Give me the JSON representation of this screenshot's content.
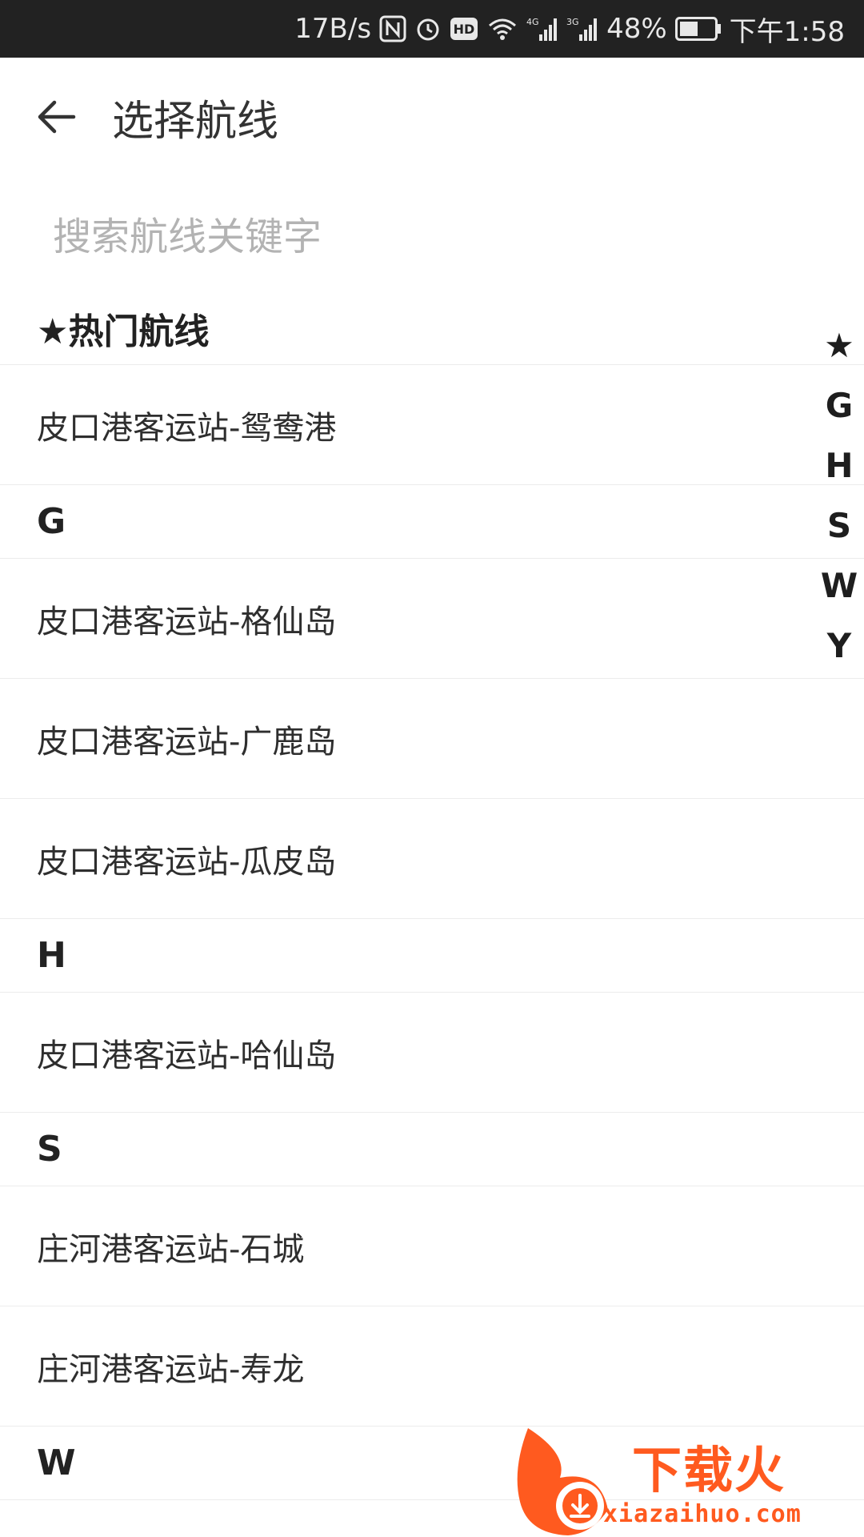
{
  "status_bar": {
    "net_speed": "17B/s",
    "battery": "48%",
    "time": "下午1:58"
  },
  "header": {
    "title": "选择航线"
  },
  "search": {
    "placeholder": "搜索航线关键字"
  },
  "sections": [
    {
      "header": "★热门航线",
      "items": [
        "皮口港客运站-鸳鸯港"
      ]
    },
    {
      "header": "G",
      "items": [
        "皮口港客运站-格仙岛",
        "皮口港客运站-广鹿岛",
        "皮口港客运站-瓜皮岛"
      ]
    },
    {
      "header": "H",
      "items": [
        "皮口港客运站-哈仙岛"
      ]
    },
    {
      "header": "S",
      "items": [
        "庄河港客运站-石城",
        "庄河港客运站-寿龙"
      ]
    },
    {
      "header": "W",
      "items": []
    }
  ],
  "index_bar": [
    "★",
    "G",
    "H",
    "S",
    "W",
    "Y"
  ],
  "watermark": {
    "brand": "下载火",
    "url": "xiazaihuo.com",
    "color": "#ff5a1f"
  }
}
